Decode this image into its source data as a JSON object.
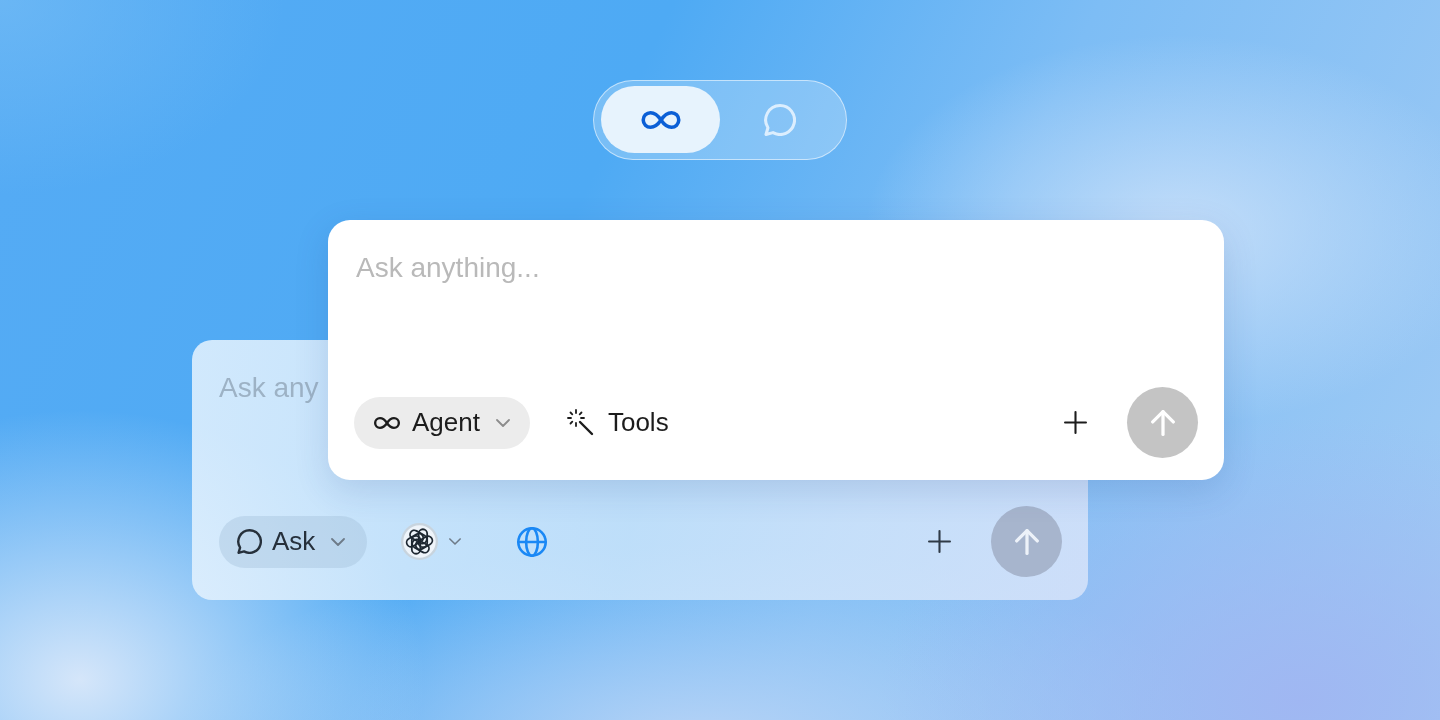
{
  "mode_toggle": {
    "options": [
      {
        "kind": "agent",
        "selected": true
      },
      {
        "kind": "ask",
        "selected": false
      }
    ]
  },
  "front_composer": {
    "placeholder": "Ask anything...",
    "toolbar": [
      {
        "kind": "agent",
        "label": "Agent"
      },
      {
        "kind": "tools",
        "label": "Tools"
      }
    ],
    "send": {
      "disabled": true
    }
  },
  "back_composer": {
    "placeholder": "Ask any",
    "toolbar": [
      {
        "kind": "ask",
        "label": "Ask"
      },
      {
        "kind": "model"
      },
      {
        "kind": "web",
        "on": true
      }
    ],
    "send": {
      "disabled": true
    }
  }
}
